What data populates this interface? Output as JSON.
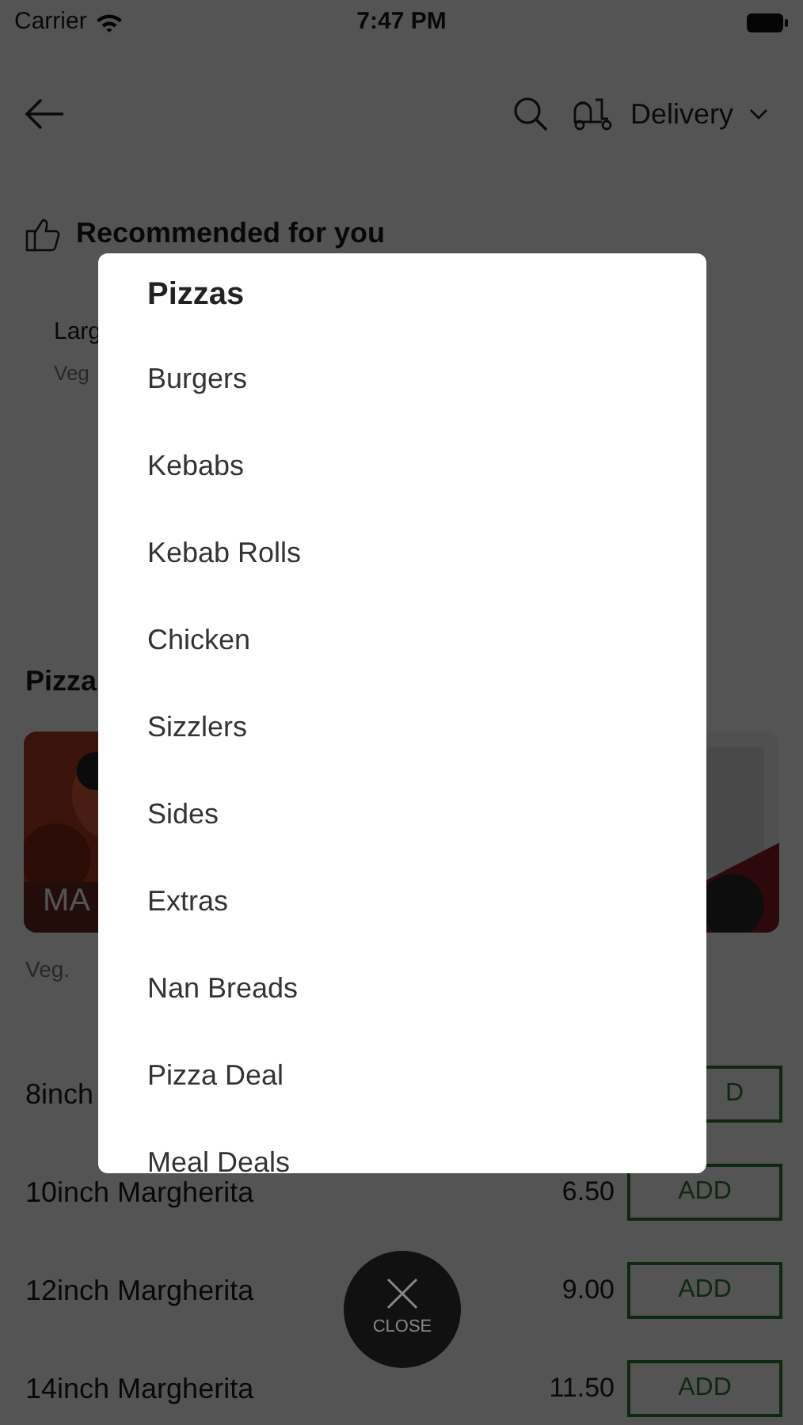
{
  "status_bar": {
    "carrier": "Carrier",
    "time": "7:47 PM"
  },
  "header": {
    "order_mode": "Delivery"
  },
  "recommended": {
    "title": "Recommended for you",
    "item": {
      "name": "Larg",
      "tag": "Veg"
    }
  },
  "section": {
    "title": "Pizza",
    "cards": [
      {
        "kind": "picture",
        "caption": "MA"
      },
      {
        "kind": "picture"
      }
    ],
    "tag": "Veg."
  },
  "items": [
    {
      "name": "8inch",
      "button": "D"
    },
    {
      "name": "10inch Margherita",
      "price": "6.50",
      "button": "ADD"
    },
    {
      "name": "12inch Margherita",
      "price": "9.00",
      "button": "ADD"
    },
    {
      "name": "14inch Margherita",
      "price": "11.50",
      "button": "ADD"
    }
  ],
  "menu": {
    "title": "Pizzas",
    "items": [
      "Burgers",
      "Kebabs",
      "Kebab Rolls",
      "Chicken",
      "Sizzlers",
      "Sides",
      "Extras",
      "Nan Breads",
      "Pizza Deal",
      "Meal Deals"
    ]
  },
  "close_button": {
    "label": "CLOSE"
  }
}
